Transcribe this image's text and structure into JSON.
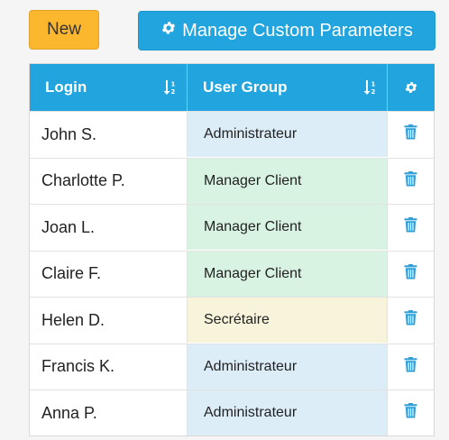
{
  "toolbar": {
    "new_label": "New",
    "manage_label": "Manage Custom Parameters",
    "manage_icon": "gear-icon"
  },
  "table": {
    "columns": [
      {
        "label": "Login",
        "sort_icon": "sort-icon"
      },
      {
        "label": "User Group",
        "sort_icon": "sort-icon"
      },
      {
        "label": "",
        "icon": "gear-icon"
      }
    ],
    "rows": [
      {
        "login": "John S.",
        "group": "Administrateur",
        "group_color": "#dcedf8",
        "action_icon": "trash-icon"
      },
      {
        "login": "Charlotte P.",
        "group": "Manager Client",
        "group_color": "#d8f3e1",
        "action_icon": "trash-icon"
      },
      {
        "login": "Joan L.",
        "group": "Manager Client",
        "group_color": "#d8f3e1",
        "action_icon": "trash-icon"
      },
      {
        "login": "Claire F.",
        "group": "Manager Client",
        "group_color": "#d8f3e1",
        "action_icon": "trash-icon"
      },
      {
        "login": "Helen D.",
        "group": "Secrétaire",
        "group_color": "#f8f4db",
        "action_icon": "trash-icon"
      },
      {
        "login": "Francis K.",
        "group": "Administrateur",
        "group_color": "#dcedf8",
        "action_icon": "trash-icon"
      },
      {
        "login": "Anna P.",
        "group": "Administrateur",
        "group_color": "#dcedf8",
        "action_icon": "trash-icon"
      }
    ]
  },
  "colors": {
    "accent": "#22a5df",
    "new_button": "#fbb72e",
    "trash": "#2fa0d8"
  }
}
